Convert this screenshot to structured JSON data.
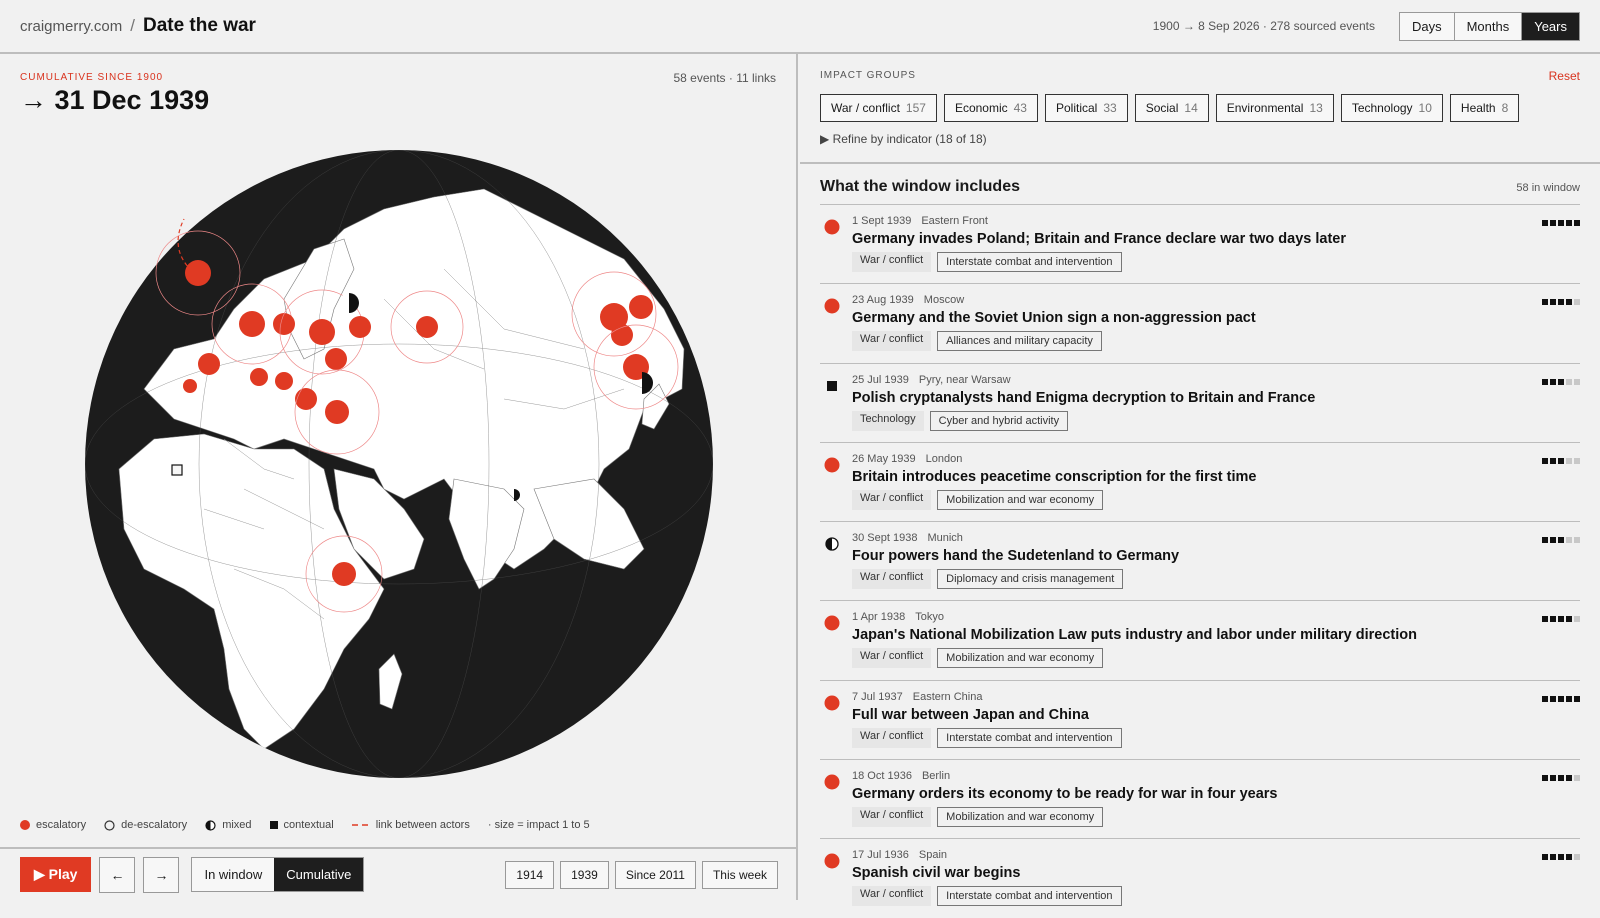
{
  "header": {
    "site": "craigmerry.com",
    "slash": "/",
    "title": "Date the war",
    "range_info": "1900 → 8 Sep 2026 · 278 sourced events",
    "granularity": [
      "Days",
      "Months",
      "Years"
    ],
    "granularity_selected": "Years"
  },
  "map_panel": {
    "cumulative_label": "CUMULATIVE SINCE 1900",
    "date": "→ 31 Dec 1939",
    "counts": "58 events · 11 links",
    "legend": {
      "escalatory": "escalatory",
      "deescalatory": "de-escalatory",
      "mixed": "mixed",
      "contextual": "contextual",
      "link": "link between actors",
      "size": "· size = impact 1 to 5"
    },
    "colors": {
      "escalatory": "#e03a23",
      "land": "#ffffff",
      "ocean": "#1c1c1c"
    }
  },
  "controls": {
    "play": "▶ Play",
    "prev": "←",
    "next": "→",
    "mode": [
      "In window",
      "Cumulative"
    ],
    "mode_selected": "Cumulative",
    "quick": [
      "1914",
      "1939",
      "Since 2011",
      "This week"
    ]
  },
  "filters": {
    "heading": "IMPACT GROUPS",
    "reset": "Reset",
    "groups": [
      {
        "label": "War / conflict",
        "count": "157"
      },
      {
        "label": "Economic",
        "count": "43"
      },
      {
        "label": "Political",
        "count": "33"
      },
      {
        "label": "Social",
        "count": "14"
      },
      {
        "label": "Environmental",
        "count": "13"
      },
      {
        "label": "Technology",
        "count": "10"
      },
      {
        "label": "Health",
        "count": "8"
      }
    ],
    "refine": "▶  Refine by indicator (18 of 18)"
  },
  "window": {
    "title": "What the window includes",
    "count": "58 in window",
    "events": [
      {
        "date": "1 Sept 1939",
        "place": "Eastern Front",
        "title": "Germany invades Poland; Britain and France declare war two days later",
        "group": "War / conflict",
        "indicator": "Interstate combat and intervention",
        "type": "escalatory",
        "impact": 5
      },
      {
        "date": "23 Aug 1939",
        "place": "Moscow",
        "title": "Germany and the Soviet Union sign a non-aggression pact",
        "group": "War / conflict",
        "indicator": "Alliances and military capacity",
        "type": "escalatory",
        "impact": 4
      },
      {
        "date": "25 Jul 1939",
        "place": "Pyry, near Warsaw",
        "title": "Polish cryptanalysts hand Enigma decryption to Britain and France",
        "group": "Technology",
        "indicator": "Cyber and hybrid activity",
        "type": "contextual",
        "impact": 3
      },
      {
        "date": "26 May 1939",
        "place": "London",
        "title": "Britain introduces peacetime conscription for the first time",
        "group": "War / conflict",
        "indicator": "Mobilization and war economy",
        "type": "escalatory",
        "impact": 3
      },
      {
        "date": "30 Sept 1938",
        "place": "Munich",
        "title": "Four powers hand the Sudetenland to Germany",
        "group": "War / conflict",
        "indicator": "Diplomacy and crisis management",
        "type": "mixed",
        "impact": 3
      },
      {
        "date": "1 Apr 1938",
        "place": "Tokyo",
        "title": "Japan's National Mobilization Law puts industry and labor under military direction",
        "group": "War / conflict",
        "indicator": "Mobilization and war economy",
        "type": "escalatory",
        "impact": 4
      },
      {
        "date": "7 Jul 1937",
        "place": "Eastern China",
        "title": "Full war between Japan and China",
        "group": "War / conflict",
        "indicator": "Interstate combat and intervention",
        "type": "escalatory",
        "impact": 5
      },
      {
        "date": "18 Oct 1936",
        "place": "Berlin",
        "title": "Germany orders its economy to be ready for war in four years",
        "group": "War / conflict",
        "indicator": "Mobilization and war economy",
        "type": "escalatory",
        "impact": 4
      },
      {
        "date": "17 Jul 1936",
        "place": "Spain",
        "title": "Spanish civil war begins",
        "group": "War / conflict",
        "indicator": "Interstate combat and intervention",
        "type": "escalatory",
        "impact": 4
      }
    ]
  }
}
